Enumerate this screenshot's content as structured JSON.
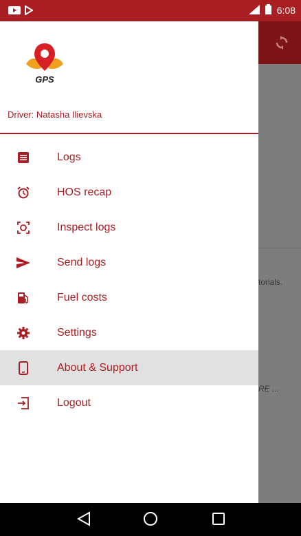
{
  "status_bar": {
    "time": "6:08",
    "colors": {
      "bar": "#a81e22"
    }
  },
  "driver": {
    "label": "Driver: Natasha Ilievska"
  },
  "logo": {
    "text": "GPS"
  },
  "menu": [
    {
      "label": "Logs",
      "icon": "list-icon"
    },
    {
      "label": "HOS recap",
      "icon": "alarm-clock-icon"
    },
    {
      "label": "Inspect logs",
      "icon": "inspect-icon"
    },
    {
      "label": "Send logs",
      "icon": "send-icon"
    },
    {
      "label": "Fuel costs",
      "icon": "fuel-icon"
    },
    {
      "label": "Settings",
      "icon": "gear-icon"
    },
    {
      "label": "About & Support",
      "icon": "phone-icon"
    },
    {
      "label": "Logout",
      "icon": "logout-icon"
    }
  ],
  "background": {
    "text1": "torials.",
    "text2": "RE ..."
  }
}
